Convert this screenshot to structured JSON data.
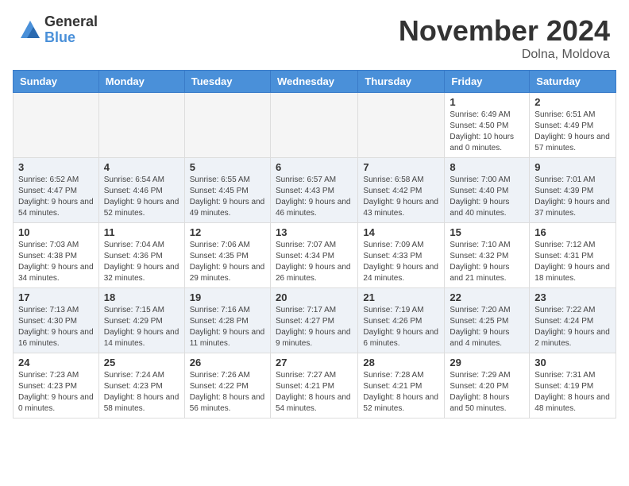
{
  "header": {
    "logo_general": "General",
    "logo_blue": "Blue",
    "month_title": "November 2024",
    "location": "Dolna, Moldova"
  },
  "calendar": {
    "days_of_week": [
      "Sunday",
      "Monday",
      "Tuesday",
      "Wednesday",
      "Thursday",
      "Friday",
      "Saturday"
    ],
    "weeks": [
      [
        {
          "day": "",
          "empty": true
        },
        {
          "day": "",
          "empty": true
        },
        {
          "day": "",
          "empty": true
        },
        {
          "day": "",
          "empty": true
        },
        {
          "day": "",
          "empty": true
        },
        {
          "day": "1",
          "sunrise": "6:49 AM",
          "sunset": "4:50 PM",
          "daylight": "10 hours and 0 minutes."
        },
        {
          "day": "2",
          "sunrise": "6:51 AM",
          "sunset": "4:49 PM",
          "daylight": "9 hours and 57 minutes."
        }
      ],
      [
        {
          "day": "3",
          "sunrise": "6:52 AM",
          "sunset": "4:47 PM",
          "daylight": "9 hours and 54 minutes."
        },
        {
          "day": "4",
          "sunrise": "6:54 AM",
          "sunset": "4:46 PM",
          "daylight": "9 hours and 52 minutes."
        },
        {
          "day": "5",
          "sunrise": "6:55 AM",
          "sunset": "4:45 PM",
          "daylight": "9 hours and 49 minutes."
        },
        {
          "day": "6",
          "sunrise": "6:57 AM",
          "sunset": "4:43 PM",
          "daylight": "9 hours and 46 minutes."
        },
        {
          "day": "7",
          "sunrise": "6:58 AM",
          "sunset": "4:42 PM",
          "daylight": "9 hours and 43 minutes."
        },
        {
          "day": "8",
          "sunrise": "7:00 AM",
          "sunset": "4:40 PM",
          "daylight": "9 hours and 40 minutes."
        },
        {
          "day": "9",
          "sunrise": "7:01 AM",
          "sunset": "4:39 PM",
          "daylight": "9 hours and 37 minutes."
        }
      ],
      [
        {
          "day": "10",
          "sunrise": "7:03 AM",
          "sunset": "4:38 PM",
          "daylight": "9 hours and 34 minutes."
        },
        {
          "day": "11",
          "sunrise": "7:04 AM",
          "sunset": "4:36 PM",
          "daylight": "9 hours and 32 minutes."
        },
        {
          "day": "12",
          "sunrise": "7:06 AM",
          "sunset": "4:35 PM",
          "daylight": "9 hours and 29 minutes."
        },
        {
          "day": "13",
          "sunrise": "7:07 AM",
          "sunset": "4:34 PM",
          "daylight": "9 hours and 26 minutes."
        },
        {
          "day": "14",
          "sunrise": "7:09 AM",
          "sunset": "4:33 PM",
          "daylight": "9 hours and 24 minutes."
        },
        {
          "day": "15",
          "sunrise": "7:10 AM",
          "sunset": "4:32 PM",
          "daylight": "9 hours and 21 minutes."
        },
        {
          "day": "16",
          "sunrise": "7:12 AM",
          "sunset": "4:31 PM",
          "daylight": "9 hours and 18 minutes."
        }
      ],
      [
        {
          "day": "17",
          "sunrise": "7:13 AM",
          "sunset": "4:30 PM",
          "daylight": "9 hours and 16 minutes."
        },
        {
          "day": "18",
          "sunrise": "7:15 AM",
          "sunset": "4:29 PM",
          "daylight": "9 hours and 14 minutes."
        },
        {
          "day": "19",
          "sunrise": "7:16 AM",
          "sunset": "4:28 PM",
          "daylight": "9 hours and 11 minutes."
        },
        {
          "day": "20",
          "sunrise": "7:17 AM",
          "sunset": "4:27 PM",
          "daylight": "9 hours and 9 minutes."
        },
        {
          "day": "21",
          "sunrise": "7:19 AM",
          "sunset": "4:26 PM",
          "daylight": "9 hours and 6 minutes."
        },
        {
          "day": "22",
          "sunrise": "7:20 AM",
          "sunset": "4:25 PM",
          "daylight": "9 hours and 4 minutes."
        },
        {
          "day": "23",
          "sunrise": "7:22 AM",
          "sunset": "4:24 PM",
          "daylight": "9 hours and 2 minutes."
        }
      ],
      [
        {
          "day": "24",
          "sunrise": "7:23 AM",
          "sunset": "4:23 PM",
          "daylight": "9 hours and 0 minutes."
        },
        {
          "day": "25",
          "sunrise": "7:24 AM",
          "sunset": "4:23 PM",
          "daylight": "8 hours and 58 minutes."
        },
        {
          "day": "26",
          "sunrise": "7:26 AM",
          "sunset": "4:22 PM",
          "daylight": "8 hours and 56 minutes."
        },
        {
          "day": "27",
          "sunrise": "7:27 AM",
          "sunset": "4:21 PM",
          "daylight": "8 hours and 54 minutes."
        },
        {
          "day": "28",
          "sunrise": "7:28 AM",
          "sunset": "4:21 PM",
          "daylight": "8 hours and 52 minutes."
        },
        {
          "day": "29",
          "sunrise": "7:29 AM",
          "sunset": "4:20 PM",
          "daylight": "8 hours and 50 minutes."
        },
        {
          "day": "30",
          "sunrise": "7:31 AM",
          "sunset": "4:19 PM",
          "daylight": "8 hours and 48 minutes."
        }
      ]
    ]
  }
}
